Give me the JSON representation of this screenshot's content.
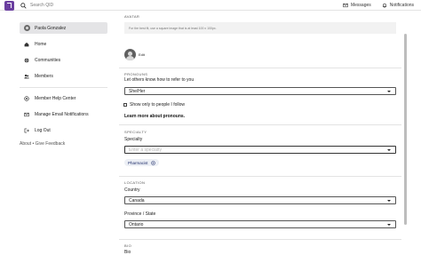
{
  "header": {
    "search_placeholder": "Search QID",
    "messages_label": "Messages",
    "notifications_label": "Notifications"
  },
  "sidebar": {
    "profile_name": "Paola Gonzalez",
    "items": [
      {
        "label": "Home",
        "icon": "home-icon"
      },
      {
        "label": "Communities",
        "icon": "globe-icon"
      },
      {
        "label": "Members",
        "icon": "members-icon"
      }
    ],
    "items2": [
      {
        "label": "Member Help Center",
        "icon": "help-icon"
      },
      {
        "label": "Manage Email Notifications",
        "icon": "mail-icon"
      },
      {
        "label": "Log Out",
        "icon": "logout-icon"
      }
    ],
    "footer": "About  •  Give Feedback"
  },
  "main": {
    "avatar_section": "AVATAR",
    "avatar_hint": "For the best fit, use a square image that is at least 100 x 100px.",
    "edit_label": "Edit",
    "pronouns_section": "PRONOUNS",
    "pronouns_prompt": "Let others know how to refer to you",
    "pronouns_value": "She/Her",
    "show_only_label": "Show only to people I follow",
    "learn_more": "Learn more about pronouns.",
    "specialty_section": "SPECIALTY",
    "specialty_label": "Specialty",
    "specialty_placeholder": "Enter a specialty",
    "specialty_chip": "Pharmacist",
    "location_section": "LOCATION",
    "country_label": "Country",
    "country_value": "Canada",
    "province_label": "Province / State",
    "province_value": "Ontario",
    "bio_section": "BIO",
    "bio_label": "Bio"
  },
  "colors": {
    "brand": "#6b3fa0",
    "chip_bg": "#eceff5",
    "chip_text": "#1f2d6a"
  }
}
